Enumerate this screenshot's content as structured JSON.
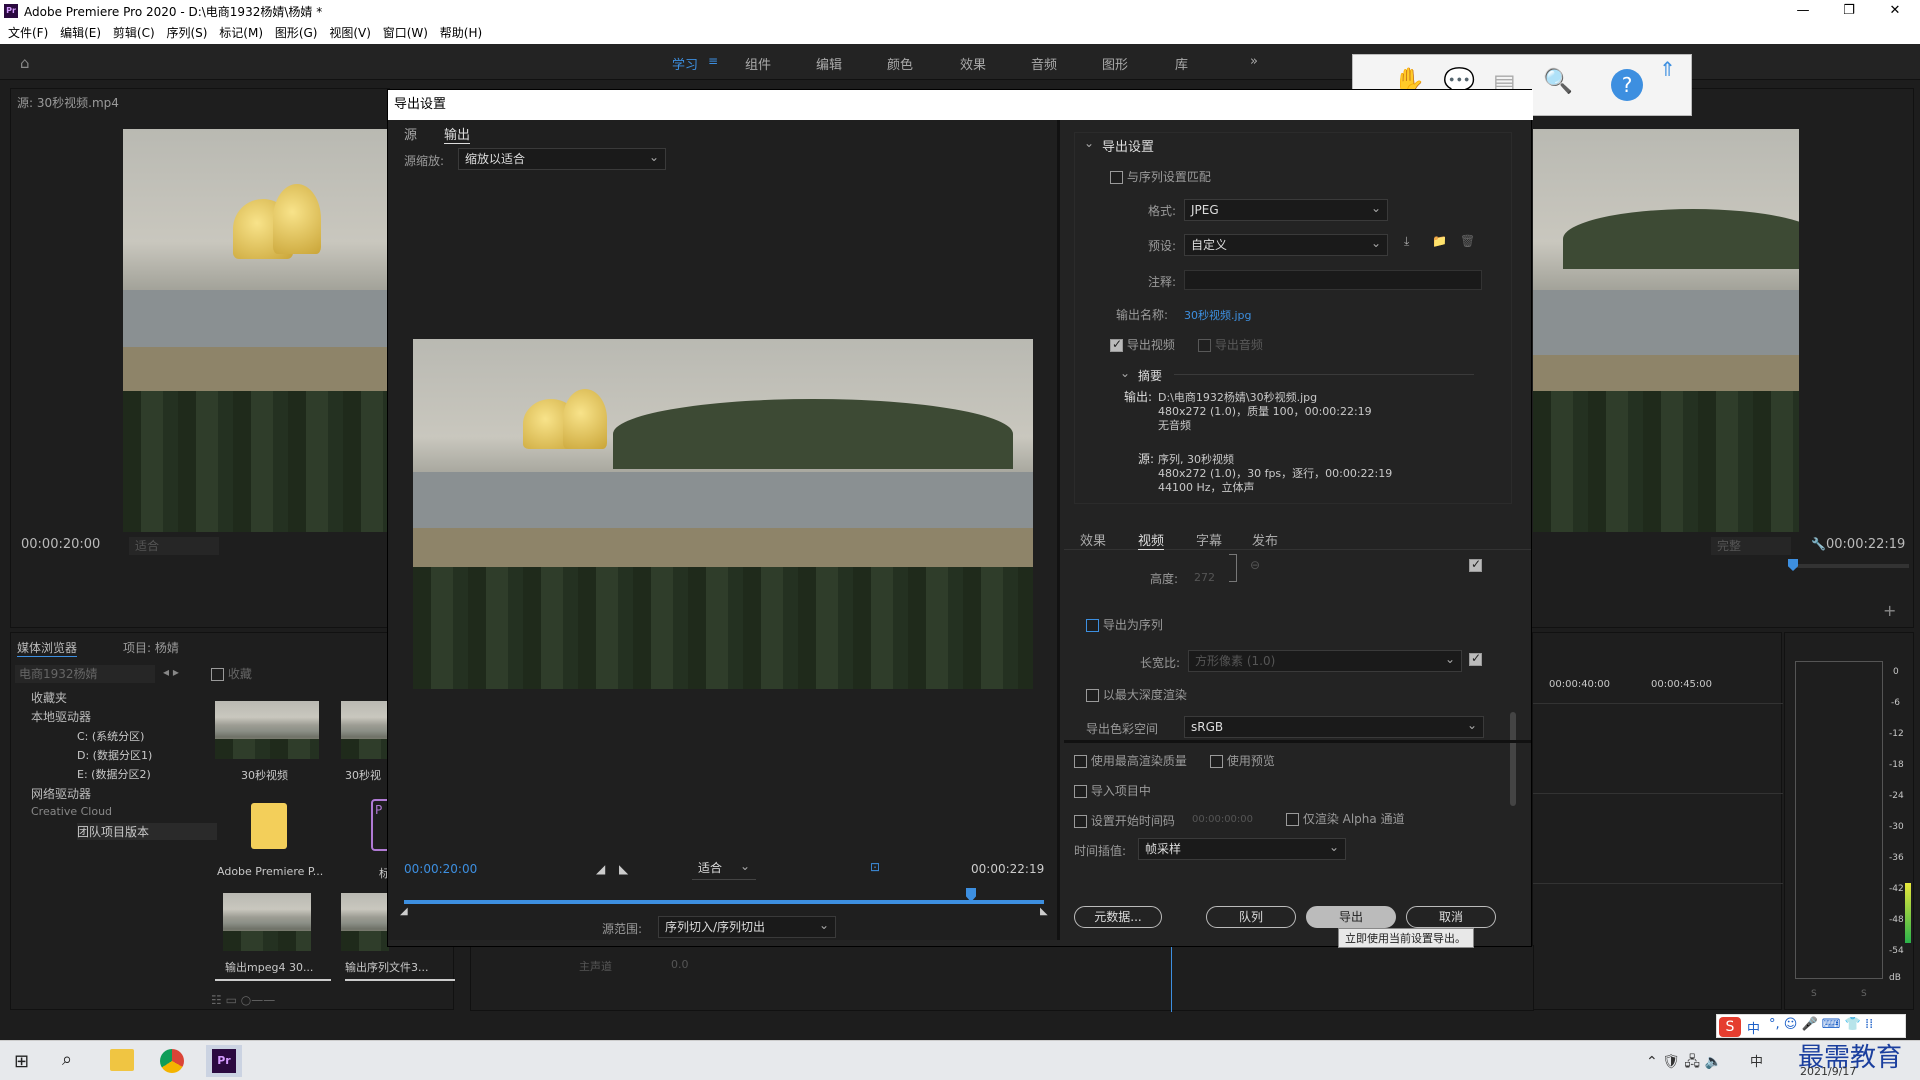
{
  "app": {
    "title": "Adobe Premiere Pro 2020 - D:\\电商1932杨婧\\杨婧 *",
    "logo": "Pr",
    "window_controls": [
      "—",
      "❐",
      "✕"
    ]
  },
  "menu": [
    "文件(F)",
    "编辑(E)",
    "剪辑(C)",
    "序列(S)",
    "标记(M)",
    "图形(G)",
    "视图(V)",
    "窗口(W)",
    "帮助(H)"
  ],
  "workspaces": {
    "active": "学习",
    "items": [
      "学习",
      "组件",
      "编辑",
      "颜色",
      "效果",
      "音频",
      "图形",
      "库"
    ],
    "more": "»"
  },
  "source_panel": {
    "title": "源: 30秒视频.mp4",
    "timecode": "00:00:20:00",
    "fit": "适合"
  },
  "program_panel": {
    "timecode": "00:00:22:19",
    "quality": "完整"
  },
  "project_panel": {
    "tabs": [
      "媒体浏览器",
      "项目: 杨婧"
    ],
    "location": "电商1932杨婧",
    "favorites_label": "收藏",
    "tree": [
      "收藏夹",
      "本地驱动器",
      "C: (系统分区)",
      "D: (数据分区1)",
      "E: (数据分区2)",
      "网络驱动器",
      "Creative Cloud",
      "团队项目版本"
    ],
    "thumbs": [
      "30秒视频",
      "30秒视",
      "Adobe Premiere P...",
      "标",
      "输出mpeg4 30...",
      "输出序列文件3..."
    ]
  },
  "timeline": {
    "ruler": [
      "00:00:40:00",
      "00:00:45:00"
    ],
    "track": "主声道",
    "track_val": "0.0"
  },
  "audio_meter": {
    "ticks": [
      "0",
      "-6",
      "-12",
      "-18",
      "-24",
      "-30",
      "-36",
      "-42",
      "-48",
      "-54",
      "dB"
    ],
    "solo": [
      "S",
      "S"
    ]
  },
  "dialog": {
    "title": "导出设置",
    "left_tabs": [
      "源",
      "输出"
    ],
    "active_left_tab": "输出",
    "source_scale_label": "源缩放:",
    "source_scale_value": "缩放以适合",
    "timecode_in": "00:00:20:00",
    "timecode_out": "00:00:22:19",
    "fit": "适合",
    "source_range_label": "源范围:",
    "source_range_value": "序列切入/序列切出",
    "export_settings_heading": "导出设置",
    "match_sequence": "与序列设置匹配",
    "format_label": "格式:",
    "format_value": "JPEG",
    "preset_label": "预设:",
    "preset_value": "自定义",
    "comment_label": "注释:",
    "output_name_label": "输出名称:",
    "output_name_value": "30秒视频.jpg",
    "export_video": "导出视频",
    "export_audio": "导出音频",
    "summary_heading": "摘要",
    "summary_output_label": "输出:",
    "summary_output_lines": [
      "D:\\电商1932杨婧\\30秒视频.jpg",
      "480x272 (1.0)，质量 100，00:00:22:19",
      "无音频"
    ],
    "summary_source_label": "源:",
    "summary_source_lines": [
      "序列, 30秒视频",
      "480x272 (1.0)，30 fps，逐行，00:00:22:19",
      "44100 Hz，立体声"
    ],
    "right_tabs": [
      "效果",
      "视频",
      "字幕",
      "发布"
    ],
    "active_right_tab": "视频",
    "height_label": "高度:",
    "height_value": "272",
    "export_as_sequence": "导出为序列",
    "aspect_label": "长宽比:",
    "aspect_value": "方形像素 (1.0)",
    "max_depth": "以最大深度渲染",
    "color_space_label": "导出色彩空间",
    "color_space_value": "sRGB",
    "max_quality": "使用最高渲染质量",
    "use_previews": "使用预览",
    "import_into_project": "导入项目中",
    "set_start_tc": "设置开始时间码",
    "start_tc_value": "00:00:00:00",
    "render_alpha": "仅渲染 Alpha 通道",
    "interp_label": "时间插值:",
    "interp_value": "帧采样",
    "btn_metadata": "元数据...",
    "btn_queue": "队列",
    "btn_export": "导出",
    "btn_cancel": "取消",
    "tooltip": "立即使用当前设置导出。"
  },
  "taskbar": {
    "ime": "中",
    "watermark": "最需教育",
    "date": "2021/9/17"
  },
  "colors": {
    "accent": "#3d8fe0",
    "panel": "#1e1e1e",
    "dialog": "#232323"
  }
}
